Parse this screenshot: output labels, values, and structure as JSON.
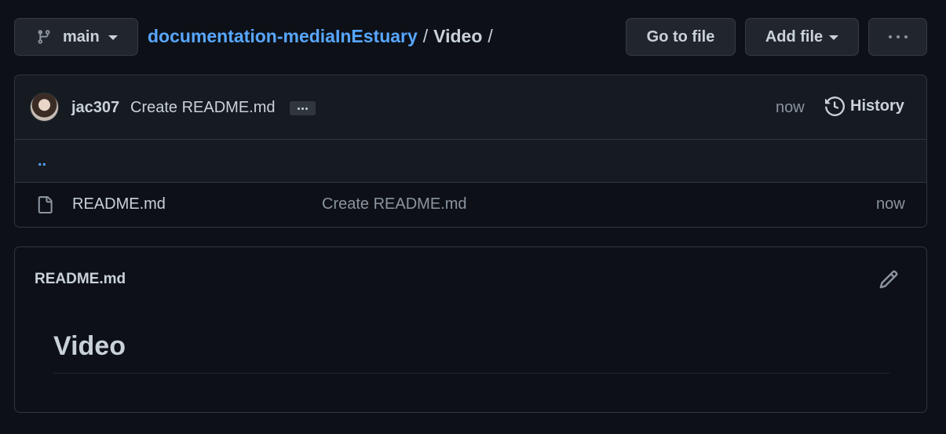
{
  "branch": {
    "name": "main"
  },
  "breadcrumb": {
    "repo": "documentation-mediaInEstuary",
    "separator": "/",
    "directory": "Video",
    "trailing_separator": "/"
  },
  "actions": {
    "go_to_file": "Go to file",
    "add_file": "Add file",
    "more_icon": "kebab-horizontal-icon"
  },
  "latest_commit": {
    "author": "jac307",
    "message": "Create README.md",
    "time": "now",
    "history_label": "History"
  },
  "parent_dir": {
    "label": ".."
  },
  "files": [
    {
      "name": "README.md",
      "commit_message": "Create README.md",
      "time": "now",
      "icon": "file-icon"
    }
  ],
  "readme": {
    "title": "README.md",
    "heading": "Video",
    "edit_icon": "pencil-icon"
  },
  "colors": {
    "background": "#0d1117",
    "surface": "#161b22",
    "border": "#30363d",
    "button": "#21262d",
    "link": "#58a6ff",
    "text": "#c9d1d9",
    "muted": "#8b949e"
  }
}
